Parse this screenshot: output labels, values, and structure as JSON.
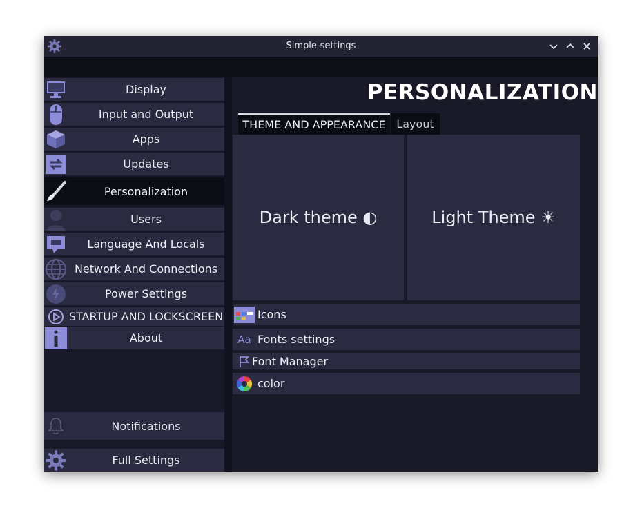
{
  "window": {
    "title": "Simple-settings"
  },
  "sidebar": {
    "items": [
      {
        "label": "Display",
        "icon": "monitor-icon"
      },
      {
        "label": "Input and Output",
        "icon": "mouse-icon"
      },
      {
        "label": "Apps",
        "icon": "package-icon"
      },
      {
        "label": "Updates",
        "icon": "refresh-icon"
      },
      {
        "label": "Personalization",
        "icon": "paintbrush-icon",
        "active": true
      },
      {
        "label": "Users",
        "icon": "user-icon"
      },
      {
        "label": "Language And Locals",
        "icon": "speech-bubble-icon"
      },
      {
        "label": "Network And Connections",
        "icon": "globe-icon"
      },
      {
        "label": "Power Settings",
        "icon": "power-icon"
      },
      {
        "label": "STARTUP AND LOCKSCREEN",
        "icon": "play-circle-icon"
      },
      {
        "label": "About",
        "icon": "info-icon"
      }
    ],
    "bottom_items": [
      {
        "label": "Notifications",
        "icon": "bell-icon"
      },
      {
        "label": "Full Settings",
        "icon": "gear-icon"
      }
    ]
  },
  "main": {
    "page_title": "PERSONALIZATION",
    "tabs": [
      {
        "label": "THEME AND APPEARANCE",
        "active": true
      },
      {
        "label": "Layout",
        "active": false
      }
    ],
    "themes": [
      {
        "label": "Dark theme",
        "glyph": "◐"
      },
      {
        "label": "Light Theme",
        "glyph": "☀"
      }
    ],
    "options": [
      {
        "label": "Icons",
        "icon": "icons-grid-icon"
      },
      {
        "label": "Fonts settings",
        "icon": "font-icon",
        "glyph": "Aa"
      },
      {
        "label": "Font Manager",
        "icon": "font-manager-icon"
      },
      {
        "label": "color",
        "icon": "color-wheel-icon"
      }
    ]
  },
  "colors": {
    "background": "#13131f",
    "panel": "#2a2a40",
    "active": "#0c0c14",
    "accent": "#8c8cd8"
  }
}
